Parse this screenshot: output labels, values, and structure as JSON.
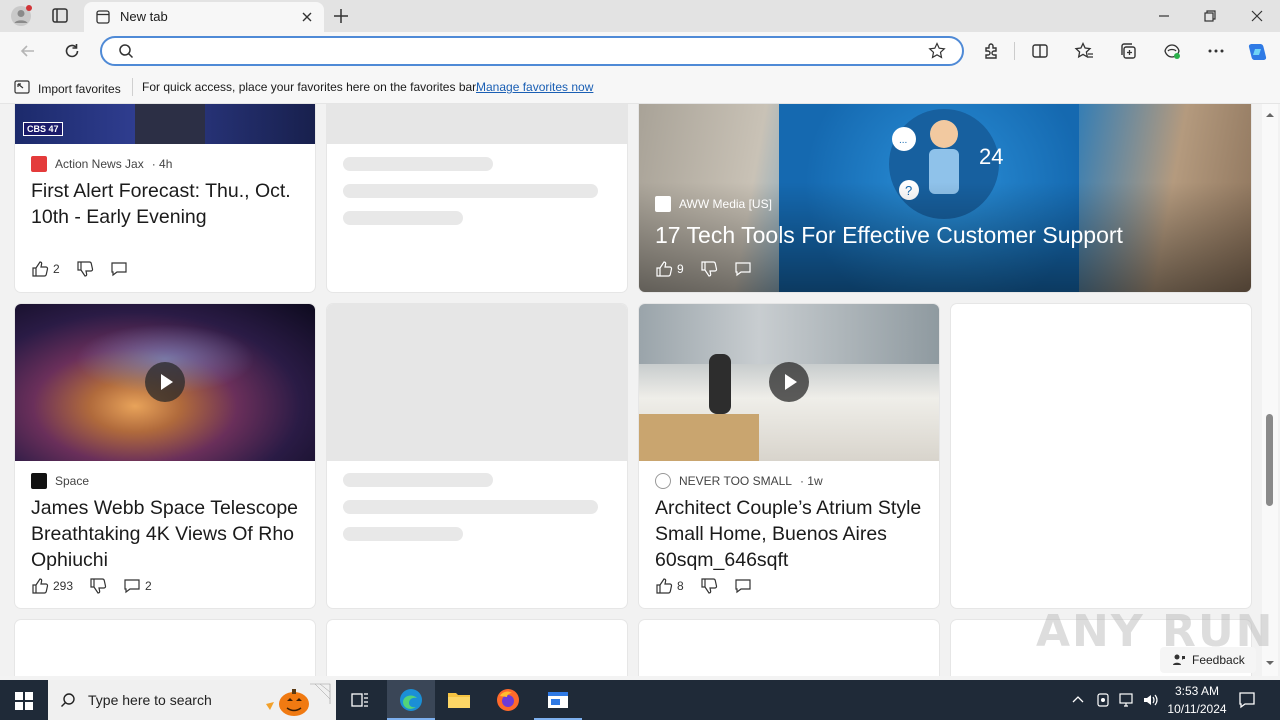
{
  "browser": {
    "tab_title": "New tab",
    "address_value": "",
    "address_placeholder": ""
  },
  "favorites_bar": {
    "import_label": "Import favorites",
    "hint": "For quick access, place your favorites here on the favorites bar.",
    "manage_link": "Manage favorites now"
  },
  "cards": {
    "news1": {
      "source": "Action News Jax",
      "age": "· 4h",
      "title": "First Alert Forecast: Thu., Oct. 10th - Early Evening",
      "likes": "2"
    },
    "featured": {
      "source": "AWW Media [US]",
      "title": "17 Tech Tools For Effective Customer Support",
      "likes": "9"
    },
    "space": {
      "source": "Space",
      "title": "James Webb Space Telescope Breathtaking 4K Views Of Rho Ophiuchi",
      "likes": "293",
      "comments": "2"
    },
    "home": {
      "source": "NEVER TOO SMALL",
      "age": "· 1w",
      "title": "Architect Couple’s Atrium Style Small Home, Buenos Aires 60sqm_646sqft",
      "likes": "8"
    }
  },
  "feedback_label": "Feedback",
  "watermark": "ANY RUN",
  "taskbar": {
    "search_placeholder": "Type here to search",
    "time": "3:53 AM",
    "date": "10/11/2024"
  },
  "colors": {
    "accent": "#4f8ad6",
    "link": "#1a5fb4",
    "taskbar": "#1f2a38"
  }
}
